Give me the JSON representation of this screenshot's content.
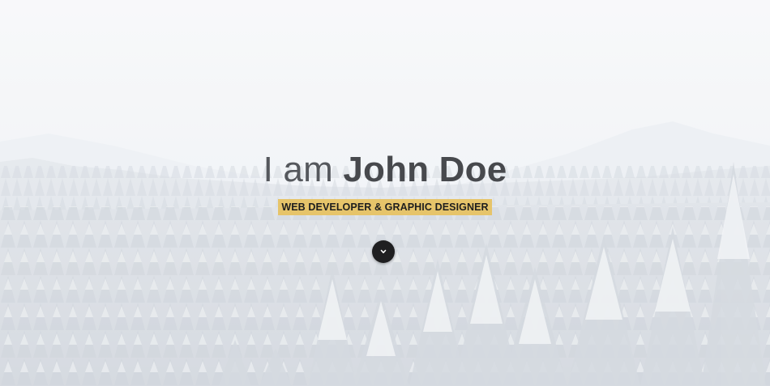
{
  "hero": {
    "title_prefix": "I am ",
    "title_name": "John Doe",
    "subtitle": "WEB DEVELOPER & GRAPHIC DESIGNER",
    "scroll_icon": "chevron-down-icon",
    "background_image": "snowy-forest-photo"
  },
  "colors": {
    "subtitle_highlight": "#e6c46a",
    "title_text": "#4a4d52",
    "scroll_button": "#1f1f21"
  }
}
